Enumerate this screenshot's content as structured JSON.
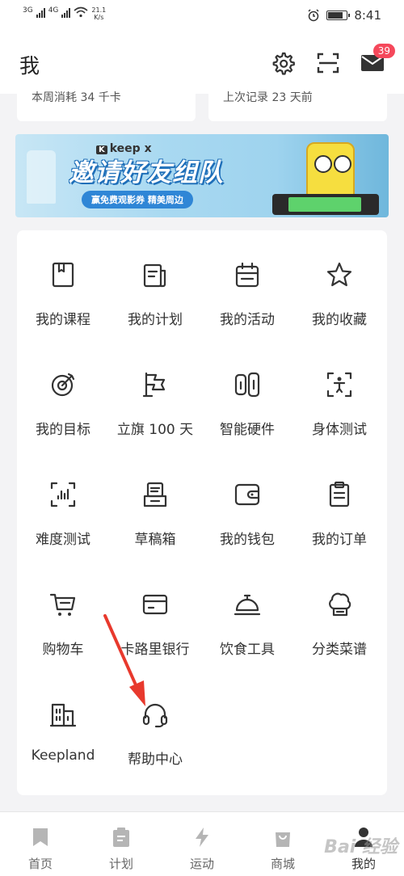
{
  "status_bar": {
    "signal1": "3G",
    "signal2": "4G",
    "net_speed": "21.1",
    "net_unit": "K/s",
    "time": "8:41",
    "battery_level": 0.75
  },
  "header": {
    "title": "我",
    "settings_icon": "gear-icon",
    "scan_icon": "scan-icon",
    "message_icon": "mail-icon",
    "message_badge": "39"
  },
  "stats": {
    "week_calories": "本周消耗 34 千卡",
    "last_record": "上次记录 23 天前"
  },
  "banner": {
    "brand": "keep x",
    "headline": "邀请好友组队",
    "subline": "赢免费观影券 精美周边"
  },
  "grid": [
    {
      "label": "我的课程",
      "icon": "book-icon"
    },
    {
      "label": "我的计划",
      "icon": "plan-icon"
    },
    {
      "label": "我的活动",
      "icon": "calendar-icon"
    },
    {
      "label": "我的收藏",
      "icon": "star-icon"
    },
    {
      "label": "我的目标",
      "icon": "target-icon"
    },
    {
      "label": "立旗 100 天",
      "icon": "flag-icon"
    },
    {
      "label": "智能硬件",
      "icon": "device-icon"
    },
    {
      "label": "身体测试",
      "icon": "body-scan-icon"
    },
    {
      "label": "难度测试",
      "icon": "bars-scan-icon"
    },
    {
      "label": "草稿箱",
      "icon": "draft-icon"
    },
    {
      "label": "我的钱包",
      "icon": "wallet-icon"
    },
    {
      "label": "我的订单",
      "icon": "clipboard-icon"
    },
    {
      "label": "购物车",
      "icon": "cart-icon"
    },
    {
      "label": "卡路里银行",
      "icon": "card-icon"
    },
    {
      "label": "饮食工具",
      "icon": "cloche-icon"
    },
    {
      "label": "分类菜谱",
      "icon": "chef-hat-icon"
    },
    {
      "label": "Keepland",
      "icon": "building-icon"
    },
    {
      "label": "帮助中心",
      "icon": "headset-icon"
    }
  ],
  "tabs": [
    {
      "label": "首页",
      "icon": "bookmark-icon"
    },
    {
      "label": "计划",
      "icon": "plan-icon"
    },
    {
      "label": "运动",
      "icon": "lightning-icon"
    },
    {
      "label": "商城",
      "icon": "bag-icon"
    },
    {
      "label": "我的",
      "icon": "user-icon",
      "active": true
    }
  ],
  "watermark": "Bai 经验",
  "colors": {
    "badge": "#f5485b",
    "arrow": "#e8392d",
    "icon_stroke": "#333333"
  }
}
